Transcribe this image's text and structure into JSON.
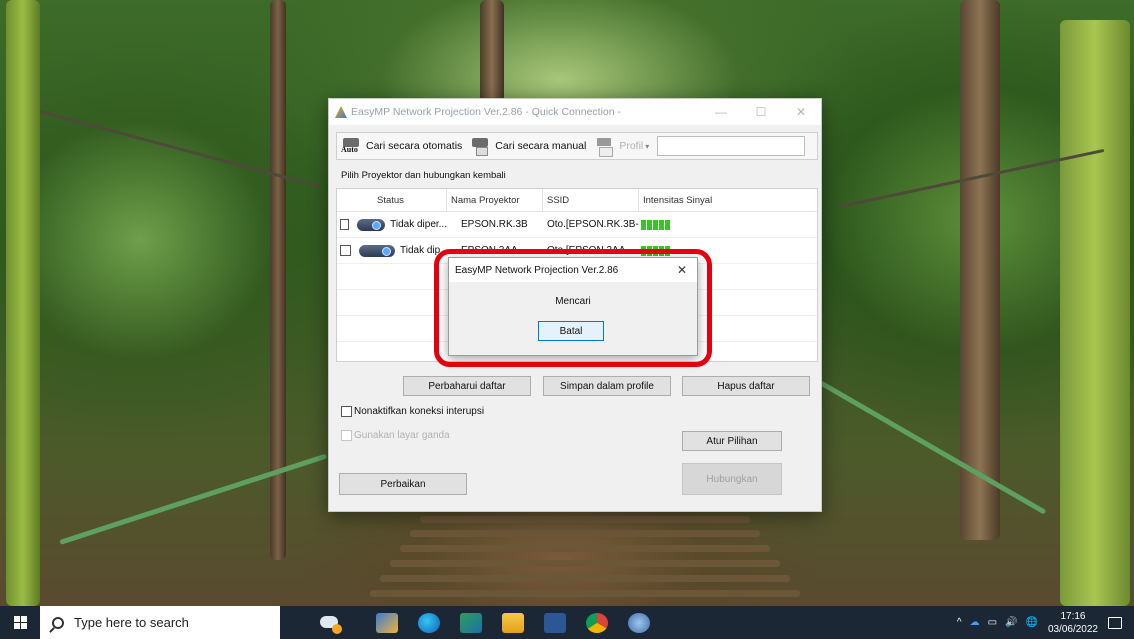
{
  "main_window": {
    "title": "EasyMP Network Projection Ver.2.86 - Quick Connection -",
    "controls": {
      "minimize": "—",
      "maximize": "☐",
      "close": "✕"
    },
    "toolbar": {
      "auto_label": "Cari secara otomatis",
      "manual_label": "Cari secara manual",
      "profile_label": "Profil",
      "profile_dropdown": "▾"
    },
    "section_label": "Pilih Proyektor dan hubungkan kembali",
    "columns": [
      "Status",
      "Nama Proyektor",
      "SSID",
      "Intensitas Sinyal"
    ],
    "rows": [
      {
        "status": "Tidak diper...",
        "name": "EPSON.RK.3B",
        "ssid": "Oto.[EPSON.RK.3B-...",
        "signal_bars": 5
      },
      {
        "status": "Tidak dip",
        "name": "EPSON.3AA",
        "ssid": "Oto.[EPSON.3AA",
        "signal_bars": 5
      }
    ],
    "buttons": {
      "refresh": "Perbaharui daftar",
      "save_profile": "Simpan dalam profile",
      "clear_list": "Hapus daftar",
      "options": "Atur Pilihan",
      "repair": "Perbaikan",
      "connect": "Hubungkan"
    },
    "checkboxes": {
      "disable_interrupt": "Nonaktifkan koneksi interupsi",
      "multi_screen": "Gunakan layar ganda"
    }
  },
  "dialog": {
    "title": "EasyMP Network Projection Ver.2.86",
    "close": "✕",
    "message": "Mencari",
    "cancel": "Batal"
  },
  "taskbar": {
    "search_placeholder": "Type here to search",
    "time": "17:16",
    "date": "03/06/2022",
    "tray_up": "^",
    "tray_volume": "🔊",
    "tray_lang": "🌐"
  },
  "colors": {
    "highlight": "#e6000e",
    "signal": "#3fbf2a",
    "taskbar": "#1b2735",
    "dialog_button_border": "#0078d7"
  }
}
